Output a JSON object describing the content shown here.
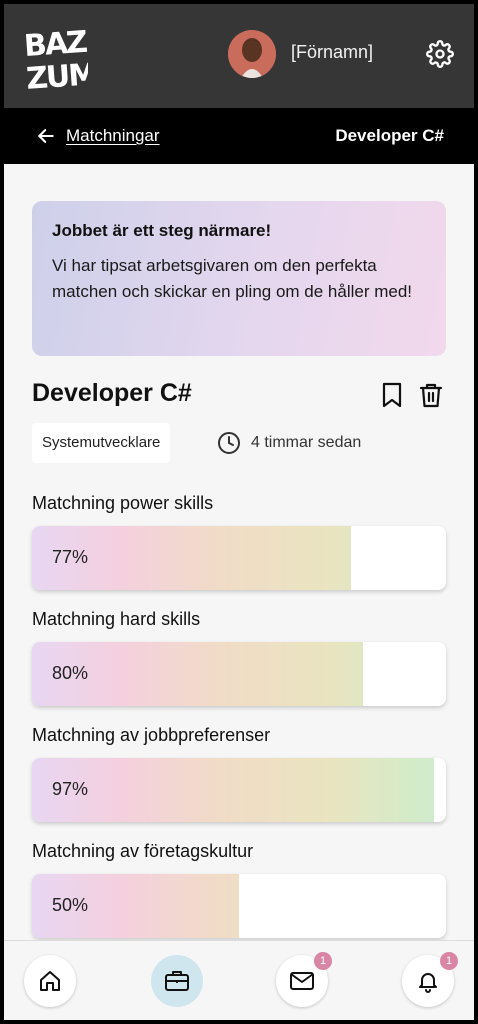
{
  "header": {
    "logo_text": "BAZZUM",
    "username": "[Förnamn]",
    "icons": [
      "avatar",
      "gear-icon"
    ]
  },
  "subbar": {
    "back_label": "Matchningar",
    "title": "Developer C#"
  },
  "info": {
    "title": "Jobbet är ett steg närmare!",
    "text": "Vi har tipsat arbetsgivaren om den perfekta matchen och skickar en pling om de håller med!"
  },
  "job": {
    "title": "Developer C#",
    "tag": "Systemutvecklare",
    "time_ago": "4 timmar sedan"
  },
  "matches": [
    {
      "label": "Matchning power skills",
      "value_text": "77%",
      "value": 77
    },
    {
      "label": "Matchning hard skills",
      "value_text": "80%",
      "value": 80
    },
    {
      "label": "Matchning av jobbpreferenser",
      "value_text": "97%",
      "value": 97
    },
    {
      "label": "Matchning av företagskultur",
      "value_text": "50%",
      "value": 50
    }
  ],
  "nav": {
    "mail_badge": "1",
    "notification_badge": "1"
  },
  "colors": {
    "header_bg": "#363636",
    "accent_active": "#cfe6ee",
    "badge": "#d985a5"
  }
}
